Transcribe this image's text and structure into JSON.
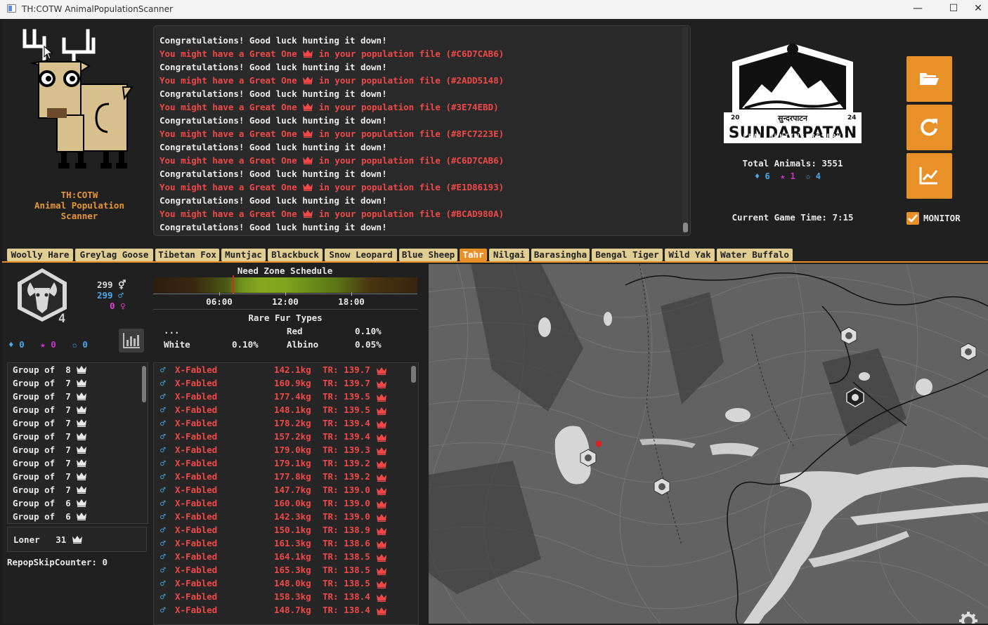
{
  "window": {
    "title": "TH:COTW AnimalPopulationScanner"
  },
  "app": {
    "name": "TH:COTW\nAnimal Population\nScanner"
  },
  "log": [
    {
      "type": "white",
      "text": "Congratulations! Good luck hunting it down!"
    },
    {
      "type": "red",
      "pre": "You might have a Great One",
      "post": "in your population file (#C6D7CAB6)"
    },
    {
      "type": "white",
      "text": "Congratulations! Good luck hunting it down!"
    },
    {
      "type": "red",
      "pre": "You might have a Great One",
      "post": "in your population file (#2ADD5148)"
    },
    {
      "type": "white",
      "text": "Congratulations! Good luck hunting it down!"
    },
    {
      "type": "red",
      "pre": "You might have a Great One",
      "post": "in your population file (#3E74EBD)"
    },
    {
      "type": "white",
      "text": "Congratulations! Good luck hunting it down!"
    },
    {
      "type": "red",
      "pre": "You might have a Great One",
      "post": "in your population file (#8FC7223E)"
    },
    {
      "type": "white",
      "text": "Congratulations! Good luck hunting it down!"
    },
    {
      "type": "red",
      "pre": "You might have a Great One",
      "post": "in your population file (#C6D7CAB6)"
    },
    {
      "type": "white",
      "text": "Congratulations! Good luck hunting it down!"
    },
    {
      "type": "red",
      "pre": "You might have a Great One",
      "post": "in your population file (#E1D86193)"
    },
    {
      "type": "white",
      "text": "Congratulations! Good luck hunting it down!"
    },
    {
      "type": "red",
      "pre": "You might have a Great One",
      "post": "in your population file (#BCAD980A)"
    },
    {
      "type": "white",
      "text": "Congratulations! Good luck hunting it down!"
    }
  ],
  "reserve": {
    "logo_year_left": "20",
    "logo_year_right": "24",
    "logo_script": "सुन्दरपाटन",
    "logo_name": "SUNDARPATAN",
    "logo_sub": "NEPAL HUNTING RESERVE",
    "total_label": "Total Animals: 3551",
    "diamonds": "6",
    "rares": "1",
    "great_ones": "4",
    "game_time": "Current Game Time: 7:15"
  },
  "buttons": {
    "open": "folder-open-icon",
    "reload": "refresh-icon",
    "stats": "chart-line-icon",
    "monitor_label": "MONITOR",
    "monitor_checked": true
  },
  "tabs": [
    "Woolly Hare",
    "Greylag Goose",
    "Tibetan Fox",
    "Muntjac",
    "Blackbuck",
    "Snow Leopard",
    "Blue Sheep",
    "Tahr",
    "Nilgai",
    "Barasingha",
    "Bengal Tiger",
    "Wild Yak",
    "Water Buffalo"
  ],
  "selected_tab": "Tahr",
  "species": {
    "great_one_count": "4",
    "total": "299",
    "male": "299",
    "female": "0",
    "diamonds": "0",
    "rares": "0",
    "great_ones": "0"
  },
  "need_zone": {
    "title": "Need Zone Schedule",
    "ticks": [
      "06:00",
      "12:00",
      "18:00"
    ],
    "current_time_fraction": 0.3
  },
  "rare_fur": {
    "title": "Rare Fur Types",
    "items": [
      {
        "name": "...",
        "pct": ""
      },
      {
        "name": "Red",
        "pct": "0.10%"
      },
      {
        "name": "White",
        "pct": "0.10%"
      },
      {
        "name": "Albino",
        "pct": "0.05%"
      }
    ]
  },
  "groups": [
    {
      "label": "Group of",
      "size": "8"
    },
    {
      "label": "Group of",
      "size": "7"
    },
    {
      "label": "Group of",
      "size": "7"
    },
    {
      "label": "Group of",
      "size": "7"
    },
    {
      "label": "Group of",
      "size": "7"
    },
    {
      "label": "Group of",
      "size": "7"
    },
    {
      "label": "Group of",
      "size": "7"
    },
    {
      "label": "Group of",
      "size": "7"
    },
    {
      "label": "Group of",
      "size": "7"
    },
    {
      "label": "Group of",
      "size": "7"
    },
    {
      "label": "Group of",
      "size": "6"
    },
    {
      "label": "Group of",
      "size": "6"
    }
  ],
  "loner": {
    "label": "Loner",
    "count": "31"
  },
  "repop": "RepopSkipCounter: 0",
  "animals": [
    {
      "sex": "♂",
      "rating": "X-Fabled",
      "weight": "142.1kg",
      "tr": "TR: 139.7"
    },
    {
      "sex": "♂",
      "rating": "X-Fabled",
      "weight": "160.9kg",
      "tr": "TR: 139.7"
    },
    {
      "sex": "♂",
      "rating": "X-Fabled",
      "weight": "177.4kg",
      "tr": "TR: 139.5"
    },
    {
      "sex": "♂",
      "rating": "X-Fabled",
      "weight": "148.1kg",
      "tr": "TR: 139.5"
    },
    {
      "sex": "♂",
      "rating": "X-Fabled",
      "weight": "178.2kg",
      "tr": "TR: 139.4"
    },
    {
      "sex": "♂",
      "rating": "X-Fabled",
      "weight": "157.2kg",
      "tr": "TR: 139.4"
    },
    {
      "sex": "♂",
      "rating": "X-Fabled",
      "weight": "179.0kg",
      "tr": "TR: 139.3"
    },
    {
      "sex": "♂",
      "rating": "X-Fabled",
      "weight": "179.1kg",
      "tr": "TR: 139.2"
    },
    {
      "sex": "♂",
      "rating": "X-Fabled",
      "weight": "177.8kg",
      "tr": "TR: 139.2"
    },
    {
      "sex": "♂",
      "rating": "X-Fabled",
      "weight": "147.7kg",
      "tr": "TR: 139.0"
    },
    {
      "sex": "♂",
      "rating": "X-Fabled",
      "weight": "160.0kg",
      "tr": "TR: 139.0"
    },
    {
      "sex": "♂",
      "rating": "X-Fabled",
      "weight": "142.3kg",
      "tr": "TR: 139.0"
    },
    {
      "sex": "♂",
      "rating": "X-Fabled",
      "weight": "150.1kg",
      "tr": "TR: 138.9"
    },
    {
      "sex": "♂",
      "rating": "X-Fabled",
      "weight": "161.3kg",
      "tr": "TR: 138.6"
    },
    {
      "sex": "♂",
      "rating": "X-Fabled",
      "weight": "164.1kg",
      "tr": "TR: 138.5"
    },
    {
      "sex": "♂",
      "rating": "X-Fabled",
      "weight": "165.3kg",
      "tr": "TR: 138.5"
    },
    {
      "sex": "♂",
      "rating": "X-Fabled",
      "weight": "148.0kg",
      "tr": "TR: 138.5"
    },
    {
      "sex": "♂",
      "rating": "X-Fabled",
      "weight": "158.3kg",
      "tr": "TR: 138.4"
    },
    {
      "sex": "♂",
      "rating": "X-Fabled",
      "weight": "148.7kg",
      "tr": "TR: 138.4"
    }
  ],
  "map": {
    "settings": "gear-icon",
    "markers": "tahr-marker-icon"
  },
  "colors": {
    "accent": "#e89128",
    "great_one": "#f04848",
    "male": "#4aa8e8",
    "female": "#e040d0",
    "diamond": "#4aa8e8",
    "rare": "#d030d0",
    "tab_bg": "#e0cd91"
  }
}
